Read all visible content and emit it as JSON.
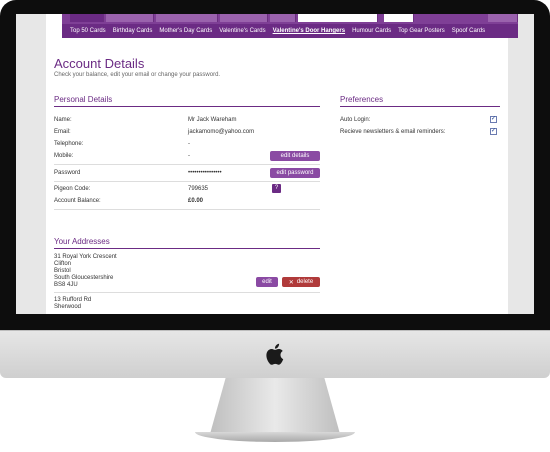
{
  "nav": {
    "sub_items": [
      "Top 50 Cards",
      "Birthday Cards",
      "Mother's Day Cards",
      "Valentine's Cards",
      "Valentine's Door Hangers",
      "Humour Cards",
      "Top Gear Posters",
      "Spoof Cards"
    ]
  },
  "page": {
    "title": "Account Details",
    "subtitle": "Check your balance, edit your email or change your password."
  },
  "personal": {
    "heading": "Personal Details",
    "name_label": "Name:",
    "name_value": "Mr Jack Wareham",
    "email_label": "Email:",
    "email_value": "jackamomo@yahoo.com",
    "telephone_label": "Telephone:",
    "telephone_value": "-",
    "mobile_label": "Mobile:",
    "mobile_value": "-",
    "edit_details": "edit details",
    "password_label": "Password",
    "password_value": "••••••••••••••••",
    "edit_password": "edit password",
    "pigeon_label": "Pigeon Code:",
    "pigeon_value": "799635",
    "help": "?",
    "balance_label": "Account Balance:",
    "balance_value": "£0.00"
  },
  "preferences": {
    "heading": "Preferences",
    "auto_login": "Auto Login:",
    "newsletter": "Recieve newsletters & email reminders:",
    "check": "✓"
  },
  "addresses": {
    "heading": "Your Addresses",
    "address1": [
      "31 Royal York Crescent",
      "Clifton",
      "Bristol",
      "South Gloucestershire",
      "BS8 4JU"
    ],
    "address2": [
      "13 Rufford Rd",
      "Sherwood"
    ],
    "edit": "edit",
    "delete": "delete",
    "delete_icon": "✕"
  }
}
